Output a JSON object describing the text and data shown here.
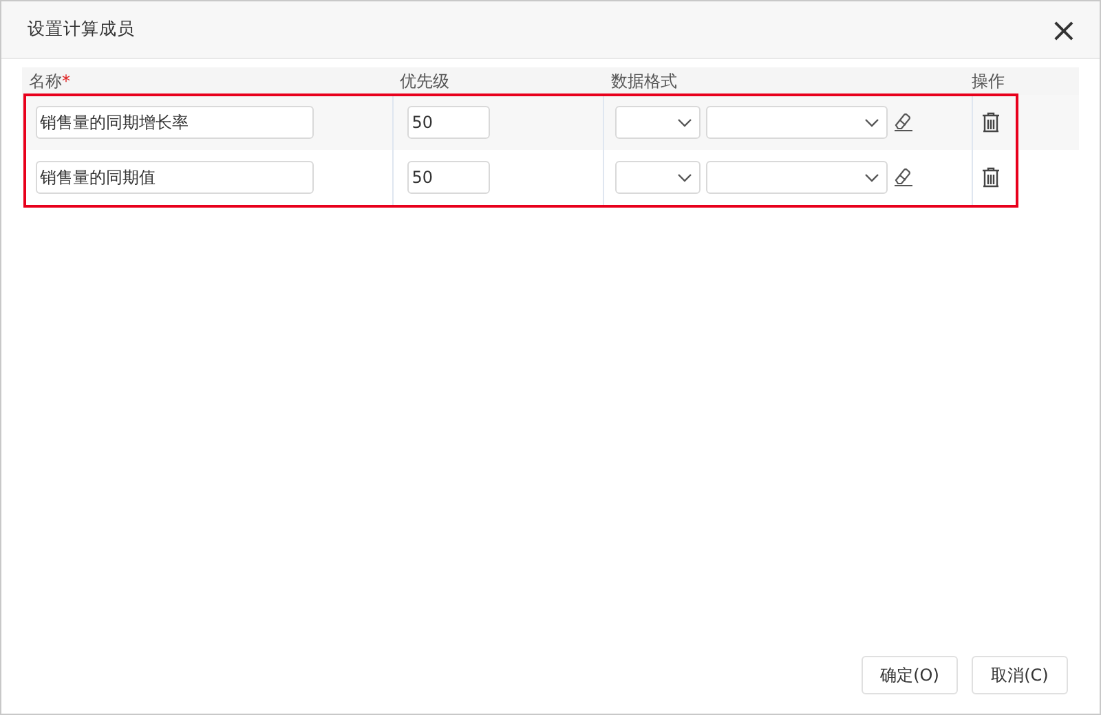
{
  "dialog": {
    "title": "设置计算成员",
    "close": "×"
  },
  "columns": [
    {
      "label": "名称",
      "required_mark": "*"
    },
    {
      "label": "优先级"
    },
    {
      "label": "数据格式"
    },
    {
      "label": "操作"
    }
  ],
  "highlight_frame": true,
  "rows": [
    {
      "name": "销售量的同期增长率",
      "priority": "50"
    },
    {
      "name": "销售量的同期值",
      "priority": "50"
    }
  ],
  "buttons": [
    {
      "label": "确定(O)"
    },
    {
      "label": "取消(C)"
    }
  ]
}
